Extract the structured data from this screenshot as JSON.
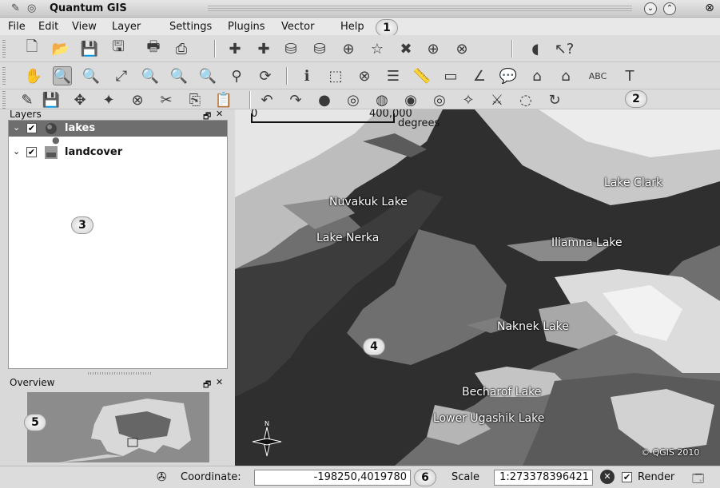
{
  "window": {
    "title": "Quantum GIS"
  },
  "menu": [
    "File",
    "Edit",
    "View",
    "Layer",
    "Settings",
    "Plugins",
    "Vector",
    "Help"
  ],
  "callouts": {
    "menu": "1",
    "toolbar": "2",
    "layers": "3",
    "map": "4",
    "overview": "5",
    "status": "6"
  },
  "layers_panel": {
    "title": "Layers",
    "layers": [
      {
        "name": "lakes",
        "checked": true,
        "selected": true,
        "icon": "vector-layer-icon"
      },
      {
        "name": "landcover",
        "checked": true,
        "selected": false,
        "icon": "raster-layer-icon"
      }
    ]
  },
  "overview_panel": {
    "title": "Overview"
  },
  "map": {
    "scalebar": {
      "start": "0",
      "end": "400,000",
      "unit": "degrees"
    },
    "labels": [
      "Nuvakuk Lake",
      "Lake Clark",
      "Lake Nerka",
      "Iliamna Lake",
      "Naknek Lake",
      "Becharof Lake",
      "Lower Ugashik Lake"
    ],
    "copyright": "© QGIS 2010"
  },
  "status": {
    "coordinate_label": "Coordinate:",
    "coordinate_value": "-198250,4019780",
    "scale_label": "Scale",
    "scale_value": "1:273378396421",
    "render_label": "Render",
    "render_checked": true
  },
  "colors": {
    "map_water": "#6f6f6f",
    "map_land_dark": "#2e2e2e",
    "map_land_light": "#e8e8e8",
    "selection": "#6e6e6e"
  }
}
